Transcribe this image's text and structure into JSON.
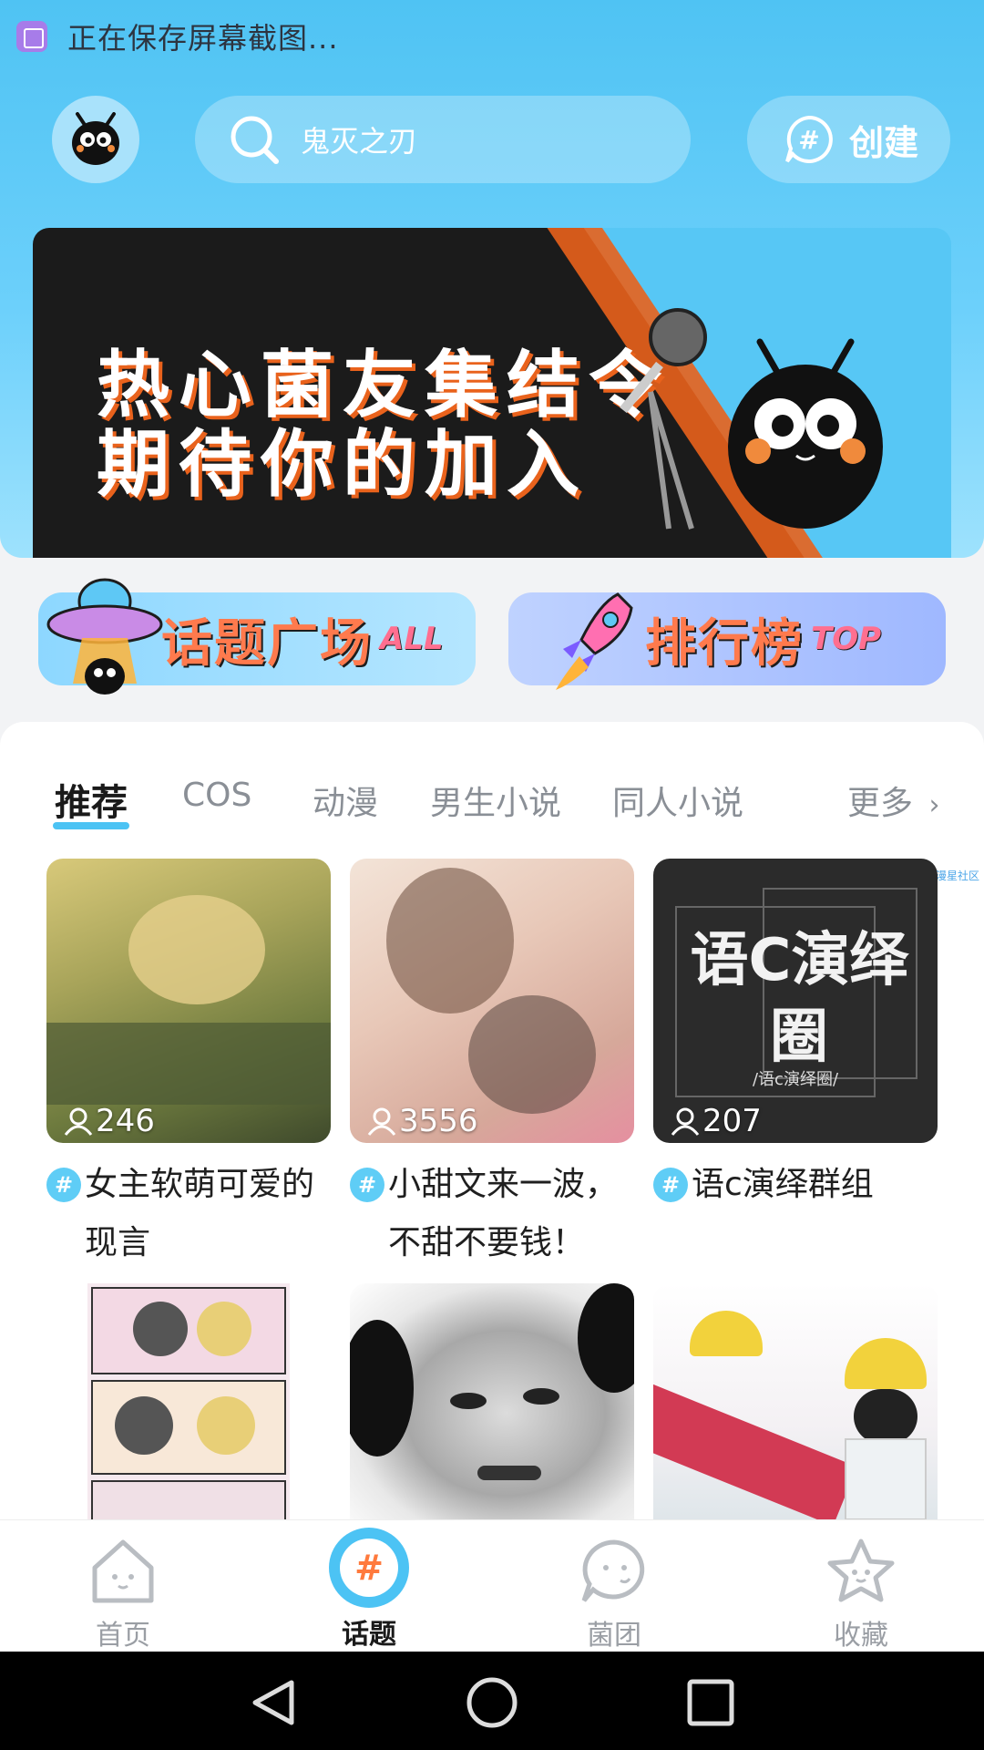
{
  "status_bar": {
    "icon": "screenshot-icon",
    "text": "正在保存屏幕截图..."
  },
  "header": {
    "avatar_icon": "mascot-avatar-icon",
    "search": {
      "icon": "search-icon",
      "placeholder": "鬼灭之刃"
    },
    "create": {
      "icon": "hash-bubble-icon",
      "label": "创建"
    }
  },
  "banner": {
    "line1": "热心菌友集结令",
    "line2": "期待你的加入"
  },
  "shortcuts": {
    "topic_square": {
      "label": "话题广场",
      "sub": "ALL"
    },
    "ranking": {
      "label": "排行榜",
      "sub": "TOP"
    }
  },
  "tabs": [
    {
      "label": "推荐",
      "active": true
    },
    {
      "label": "COS"
    },
    {
      "label": "动漫"
    },
    {
      "label": "男生小说"
    },
    {
      "label": "同人小说"
    },
    {
      "label": "更多"
    }
  ],
  "side_tag": "漫星社区",
  "cards": [
    {
      "count": "246",
      "title": "女主软萌可爱的现言"
    },
    {
      "count": "3556",
      "title": "小甜文来一波，不甜不要钱！"
    },
    {
      "count": "207",
      "title": "语c演绎群组",
      "cover_text": "语C演绎圈",
      "cover_sub": "/语c演绎圈/"
    }
  ],
  "bottom_nav": [
    {
      "label": "首页",
      "icon": "home-icon"
    },
    {
      "label": "话题",
      "icon": "hash-icon",
      "active": true
    },
    {
      "label": "菌团",
      "icon": "chat-face-icon"
    },
    {
      "label": "收藏",
      "icon": "star-icon"
    }
  ],
  "colors": {
    "accent": "#4cc3f4",
    "orange": "#ff7a3d"
  }
}
